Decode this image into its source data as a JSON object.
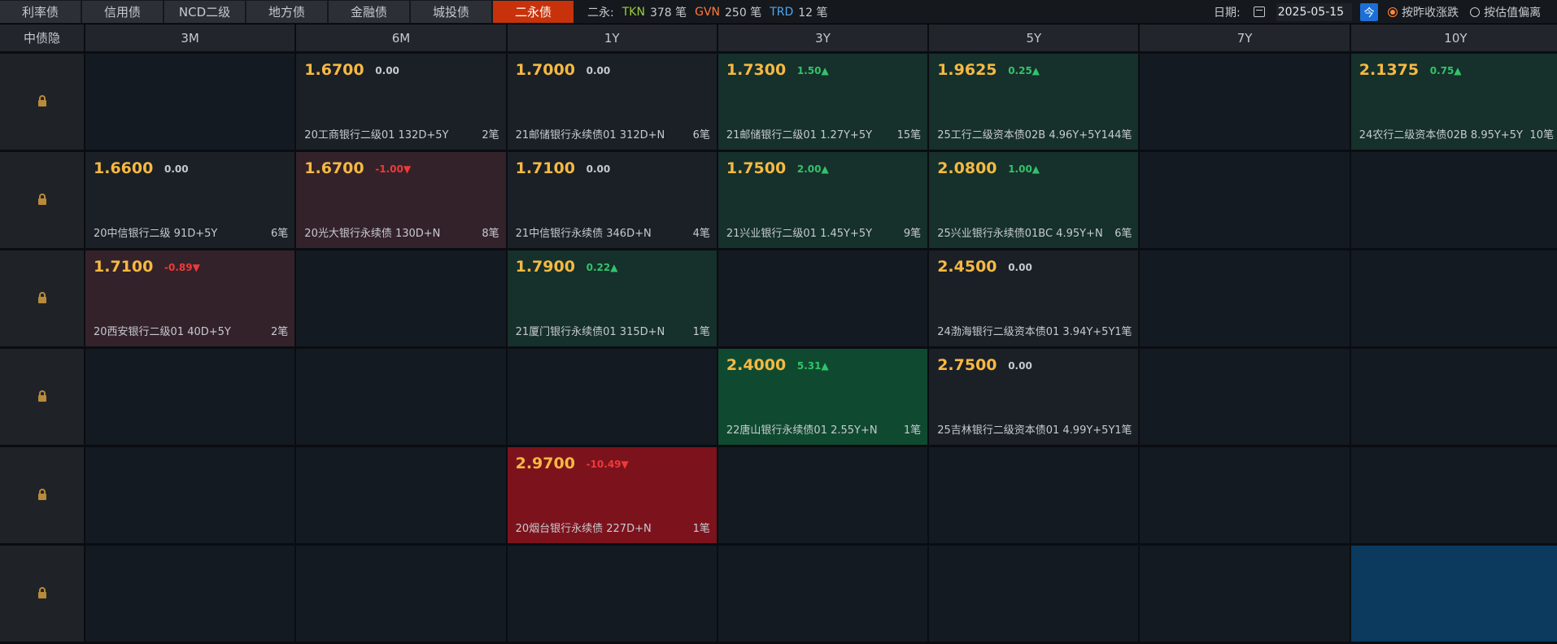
{
  "tabs": [
    {
      "label": "利率债",
      "active": false
    },
    {
      "label": "信用债",
      "active": false
    },
    {
      "label": "NCD二级",
      "active": false
    },
    {
      "label": "地方债",
      "active": false
    },
    {
      "label": "金融债",
      "active": false
    },
    {
      "label": "城投债",
      "active": false
    },
    {
      "label": "二永债",
      "active": true
    }
  ],
  "stats": {
    "prefix": "二永:",
    "tkn_label": "TKN",
    "tkn_value": "378 笔",
    "gvn_label": "GVN",
    "gvn_value": "250 笔",
    "trd_label": "TRD",
    "trd_value": "12 笔"
  },
  "date": {
    "label": "日期:",
    "value": "2025-05-15",
    "today_label": "今",
    "radio_close": "按昨收涨跌",
    "radio_est": "按估值偏离"
  },
  "table": {
    "corner": "中债隐",
    "columns": [
      "3M",
      "6M",
      "1Y",
      "3Y",
      "5Y",
      "7Y",
      "10Y"
    ],
    "rows": [
      [
        {
          "empty": true
        },
        {
          "price": "1.6700",
          "change": "0.00",
          "dir": "flat",
          "bond": "20工商银行二级01 132D+5Y",
          "count": "2笔",
          "tone": "neutral"
        },
        {
          "price": "1.7000",
          "change": "0.00",
          "dir": "flat",
          "bond": "21邮储银行永续债01 312D+N",
          "count": "6笔",
          "tone": "neutral"
        },
        {
          "price": "1.7300",
          "change": "1.50▲",
          "dir": "up",
          "bond": "21邮储银行二级01 1.27Y+5Y",
          "count": "15笔",
          "tone": "green"
        },
        {
          "price": "1.9625",
          "change": "0.25▲",
          "dir": "up",
          "bond": "25工行二级资本债02B 4.96Y+5Y",
          "count": "144笔",
          "tone": "green"
        },
        {
          "empty": true
        },
        {
          "price": "2.1375",
          "change": "0.75▲",
          "dir": "up",
          "bond": "24农行二级资本债02B 8.95Y+5Y",
          "count": "10笔",
          "tone": "green"
        }
      ],
      [
        {
          "price": "1.6600",
          "change": "0.00",
          "dir": "flat",
          "bond": "20中信银行二级 91D+5Y",
          "count": "6笔",
          "tone": "neutral"
        },
        {
          "price": "1.6700",
          "change": "-1.00▼",
          "dir": "down",
          "bond": "20光大银行永续债 130D+N",
          "count": "8笔",
          "tone": "red"
        },
        {
          "price": "1.7100",
          "change": "0.00",
          "dir": "flat",
          "bond": "21中信银行永续债 346D+N",
          "count": "4笔",
          "tone": "neutral"
        },
        {
          "price": "1.7500",
          "change": "2.00▲",
          "dir": "up",
          "bond": "21兴业银行二级01 1.45Y+5Y",
          "count": "9笔",
          "tone": "green"
        },
        {
          "price": "2.0800",
          "change": "1.00▲",
          "dir": "up",
          "bond": "25兴业银行永续债01BC 4.95Y+N",
          "count": "6笔",
          "tone": "green"
        },
        {
          "empty": true
        },
        {
          "empty": true
        }
      ],
      [
        {
          "price": "1.7100",
          "change": "-0.89▼",
          "dir": "down",
          "bond": "20西安银行二级01 40D+5Y",
          "count": "2笔",
          "tone": "red"
        },
        {
          "empty": true
        },
        {
          "price": "1.7900",
          "change": "0.22▲",
          "dir": "up",
          "bond": "21厦门银行永续债01 315D+N",
          "count": "1笔",
          "tone": "green"
        },
        {
          "empty": true
        },
        {
          "price": "2.4500",
          "change": "0.00",
          "dir": "flat",
          "bond": "24渤海银行二级资本债01 3.94Y+5Y",
          "count": "1笔",
          "tone": "neutral"
        },
        {
          "empty": true
        },
        {
          "empty": true
        }
      ],
      [
        {
          "empty": true
        },
        {
          "empty": true
        },
        {
          "empty": true
        },
        {
          "price": "2.4000",
          "change": "5.31▲",
          "dir": "up",
          "bond": "22唐山银行永续债01 2.55Y+N",
          "count": "1笔",
          "tone": "dgreen"
        },
        {
          "price": "2.7500",
          "change": "0.00",
          "dir": "flat",
          "bond": "25吉林银行二级资本债01 4.99Y+5Y",
          "count": "1笔",
          "tone": "neutral"
        },
        {
          "empty": true
        },
        {
          "empty": true
        }
      ],
      [
        {
          "empty": true
        },
        {
          "empty": true
        },
        {
          "price": "2.9700",
          "change": "-10.49▼",
          "dir": "down",
          "bond": "20烟台银行永续债 227D+N",
          "count": "1笔",
          "tone": "bred"
        },
        {
          "empty": true
        },
        {
          "empty": true
        },
        {
          "empty": true
        },
        {
          "empty": true
        }
      ],
      [
        {
          "empty": true
        },
        {
          "empty": true
        },
        {
          "empty": true
        },
        {
          "empty": true
        },
        {
          "empty": true
        },
        {
          "empty": true
        },
        {
          "empty": true,
          "tone": "blue"
        }
      ]
    ]
  },
  "colors": {
    "active_tab": "#c8320a",
    "price": "#f5b942",
    "up": "#33c26a",
    "down": "#ee3a3a",
    "tkn": "#9ccd3c",
    "gvn": "#ff7a3a",
    "trd": "#4ea8f0"
  },
  "icons": {
    "row_lock": "lock-icon",
    "date_picker": "calendar-icon"
  }
}
